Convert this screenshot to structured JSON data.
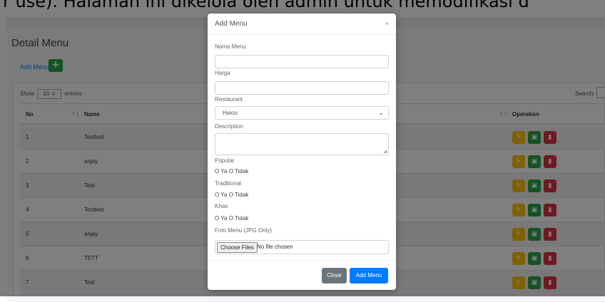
{
  "caption": "r use). Halaman ini dikelola oleh admin untuk memodifikasi d",
  "page": {
    "title": "Detail Menu",
    "add_menu_label": "Add Menu",
    "add_icon": "+",
    "show_label": "Show",
    "show_value": "10 ≑",
    "entries_label": "entries",
    "search_label": "Search:"
  },
  "table": {
    "headers": {
      "no": "No",
      "name": "Name",
      "operation": "Operation"
    },
    "sort_icon": "↑↓",
    "rows": [
      {
        "no": "1",
        "name": "Testtest"
      },
      {
        "no": "2",
        "name": "anjay"
      },
      {
        "no": "3",
        "name": "Test"
      },
      {
        "no": "4",
        "name": "Testtest"
      },
      {
        "no": "5",
        "name": "anjay"
      },
      {
        "no": "6",
        "name": "TETT"
      },
      {
        "no": "7",
        "name": "Test"
      }
    ]
  },
  "modal": {
    "title": "Add Menu",
    "close_symbol": "×",
    "fields": {
      "nama_menu": "Nama Menu",
      "harga": "Harga",
      "restaurant": "Restaurant",
      "restaurant_value": "Haiou",
      "description": "Description",
      "popular": "Popular",
      "traditional": "Traditional",
      "khas": "Khas",
      "radio_options": "O Ya O Tidak",
      "foto_menu": "Foto Menu (JPG Only)",
      "choose_files": "Choose Files",
      "no_file": "No file chosen"
    },
    "buttons": {
      "close": "Close",
      "add": "Add Menu"
    }
  },
  "colors": {
    "primary": "#007bff",
    "success": "#28a745",
    "warning": "#ffc107",
    "danger": "#dc3545",
    "secondary": "#6c757d"
  }
}
